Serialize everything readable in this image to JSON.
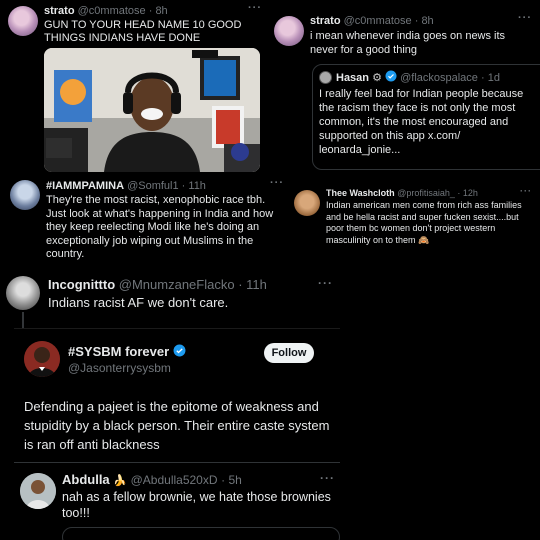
{
  "tweets": {
    "strato1": {
      "name": "strato",
      "handle": "@c0mmatose",
      "time": "· 8h",
      "text": "GUN TO YOUR HEAD NAME 10 GOOD THINGS INDIANS HAVE DONE",
      "more": "···"
    },
    "strato2": {
      "name": "strato",
      "handle": "@c0mmatose",
      "time": "· 8h",
      "text": "i mean whenever india goes on news its never for a good thing",
      "more": "···"
    },
    "quote": {
      "name": "Hasan",
      "badges": "⚙",
      "handle": "@flackospalace",
      "time": "· 1d",
      "text": "I really feel bad for Indian people because the racism they face is not only the most common, it's the most encouraged and supported on this app x.com/ leonarda_jonie..."
    },
    "iamm": {
      "name": "#IAMMPAMINA",
      "handle": "@Somful1",
      "time": "· 11h",
      "text": "They're the most racist, xenophobic race tbh. Just look at what's happening in India and how they keep reelecting Modi like he's doing an exceptionally job wiping out Muslims in the country.",
      "more": "···"
    },
    "washcloth": {
      "name": "Thee Washcloth",
      "handle": "@profitisaiah_",
      "time": "· 12h",
      "text": "Indian american men come from rich ass families and be hella racist and super fucken sexist....but poor them bc women don't project western masculinity on to them 🙈",
      "more": "···"
    },
    "incog": {
      "name": "Incognittto",
      "handle": "@MnumzaneFlacko",
      "time": "· 11h",
      "text": "Indians racist AF we don't care.",
      "more": "···"
    },
    "sysbm": {
      "name": "#SYSBM forever",
      "handle": "@Jasonterrysysbm",
      "follow_label": "Follow",
      "text": "Defending a pajeet is the epitome of weakness and stupidity by a black person. Their entire caste system is ran off anti blackness"
    },
    "abdulla": {
      "name": "Abdulla",
      "emoji": "🍌",
      "handle": "@Abdulla520xD",
      "time": "· 5h",
      "text": "nah as a fellow brownie, we hate those brownies too!!!",
      "more": "···"
    }
  },
  "colors": {
    "background": "#000000",
    "text": "#e7e9ea",
    "muted": "#71767b",
    "verified": "#1d9bf0",
    "border": "#2f3336"
  },
  "icons": {
    "verified": "verified-badge-icon",
    "more": "more-options-icon"
  }
}
